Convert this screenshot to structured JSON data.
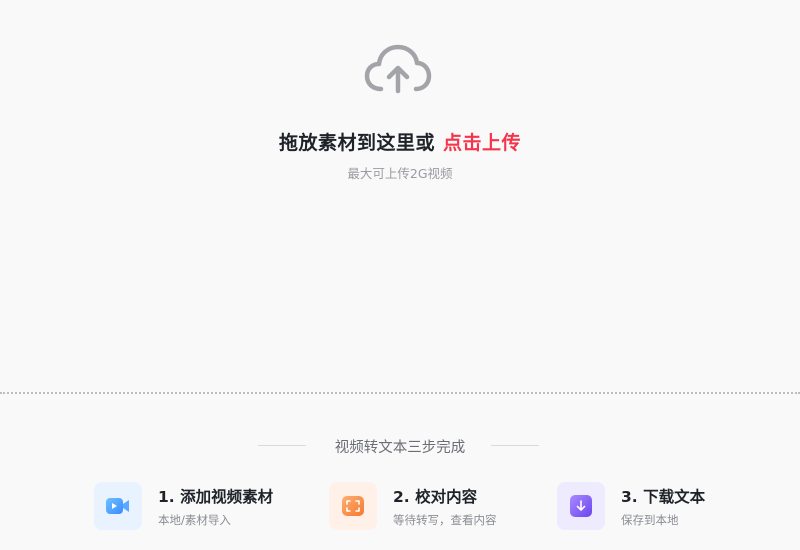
{
  "upload": {
    "headline": "拖放素材到这里或",
    "cta": "点击上传",
    "limit": "最大可上传2G视频"
  },
  "steps": {
    "title": "视频转文本三步完成",
    "items": [
      {
        "title": "1. 添加视频素材",
        "desc": "本地/素材导入",
        "icon": "video-camera-icon",
        "color": "#4da3ff"
      },
      {
        "title": "2. 校对内容",
        "desc": "等待转写，查看内容",
        "icon": "scan-frame-icon",
        "color": "#f5843c"
      },
      {
        "title": "3. 下载文本",
        "desc": "保存到本地",
        "icon": "download-icon",
        "color": "#7b5cf5"
      }
    ]
  }
}
